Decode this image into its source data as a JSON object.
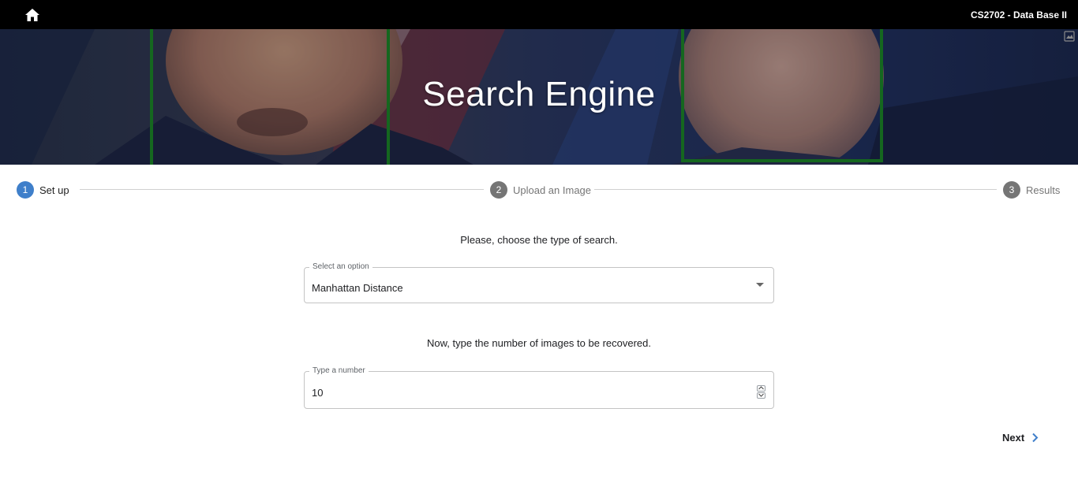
{
  "header": {
    "home_icon": "home-icon",
    "course_title": "CS2702 - Data Base II"
  },
  "hero": {
    "title": "Search Engine",
    "corner_icon": "image-icon"
  },
  "stepper": {
    "steps": [
      {
        "number": "1",
        "label": "Set up",
        "state": "active"
      },
      {
        "number": "2",
        "label": "Upload an Image",
        "state": "inactive"
      },
      {
        "number": "3",
        "label": "Results",
        "state": "inactive"
      }
    ]
  },
  "search_type": {
    "prompt": "Please, choose the type of search.",
    "label": "Select an option",
    "selected": "Manhattan Distance"
  },
  "image_count": {
    "prompt": "Now, type the number of images to be recovered.",
    "label": "Type a number",
    "value": "10"
  },
  "actions": {
    "next_label": "Next",
    "next_icon": "chevron-right-icon"
  },
  "colors": {
    "topbar": "#000000",
    "accent": "#3f7fca",
    "inactive_step": "#757575"
  }
}
